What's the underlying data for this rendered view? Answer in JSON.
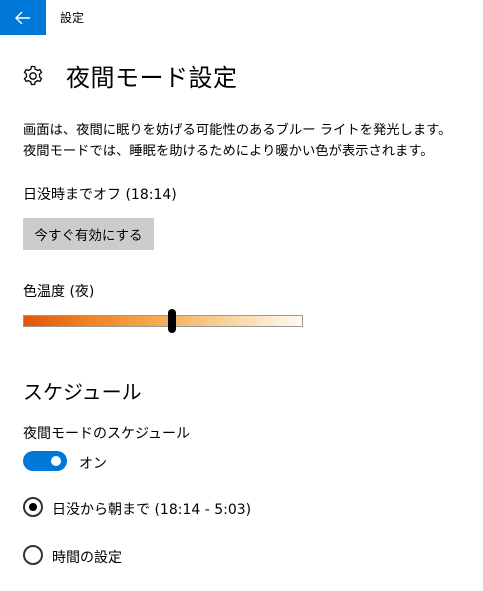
{
  "window": {
    "app_title": "設定",
    "back_icon": "back-arrow-icon",
    "accent_color": "#0078d7"
  },
  "header": {
    "icon": "gear-icon",
    "title": "夜間モード設定"
  },
  "description": "画面は、夜間に眠りを妨げる可能性のあるブルー ライトを発光します。夜間モードでは、睡眠を助けるためにより暖かい色が表示されます。",
  "status_text": "日没時までオフ (18:14)",
  "turn_on_now_button": "今すぐ有効にする",
  "color_temperature": {
    "label": "色温度 (夜)",
    "value_fraction": 0.53
  },
  "schedule": {
    "section_title": "スケジュール",
    "toggle_label": "夜間モードのスケジュール",
    "toggle_state": "オン",
    "toggle_on": true,
    "options": [
      {
        "label": "日没から朝まで (18:14 - 5:03)",
        "selected": true
      },
      {
        "label": "時間の設定",
        "selected": false
      }
    ]
  }
}
